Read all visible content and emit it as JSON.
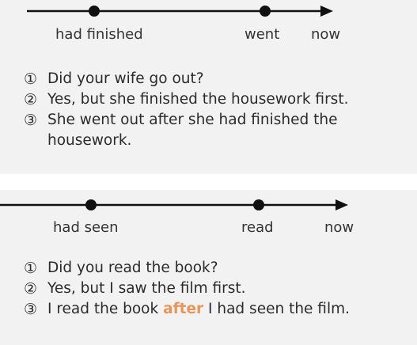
{
  "panels": [
    {
      "timeline": {
        "events": [
          "had finished",
          "went",
          "now"
        ]
      },
      "sentences": [
        {
          "marker": "①",
          "text": "Did your wife go out?"
        },
        {
          "marker": "②",
          "text": "Yes, but she finished the housework first."
        },
        {
          "marker": "③",
          "text": "She went out after she had finished the housework."
        }
      ]
    },
    {
      "timeline": {
        "events": [
          "had seen",
          "read",
          "now"
        ]
      },
      "sentences": [
        {
          "marker": "①",
          "text": "Did you read the book?"
        },
        {
          "marker": "②",
          "text": "Yes, but I saw the film first."
        },
        {
          "marker": "③",
          "text_before": "I read the book ",
          "highlight": "after",
          "text_after": " I had seen the film."
        }
      ]
    }
  ],
  "colors": {
    "highlight": "#e9945a",
    "line": "#111111",
    "panel_bg": "#f2f2f2"
  }
}
